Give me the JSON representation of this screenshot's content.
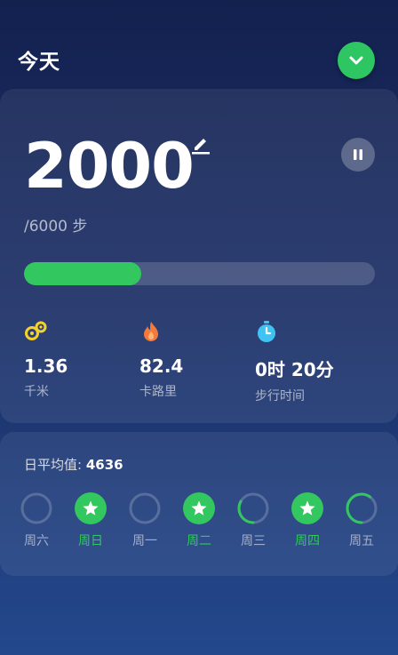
{
  "header": {
    "title": "今天"
  },
  "today": {
    "steps": "2000",
    "goal_text": "/6000 步",
    "progress": 0.333
  },
  "stats": [
    {
      "icon": "distance-icon",
      "value": "1.36",
      "label": "千米"
    },
    {
      "icon": "flame-icon",
      "value": "82.4",
      "label": "卡路里"
    },
    {
      "icon": "timer-icon",
      "value": "0时 20分",
      "label": "步行时间"
    }
  ],
  "weekly": {
    "avg_label": "日平均值:",
    "avg_value": "4636",
    "days": [
      {
        "label": "周六",
        "status": "empty",
        "progress": 0
      },
      {
        "label": "周日",
        "status": "done",
        "progress": 1
      },
      {
        "label": "周一",
        "status": "empty",
        "progress": 0
      },
      {
        "label": "周二",
        "status": "done",
        "progress": 1
      },
      {
        "label": "周三",
        "status": "partial",
        "progress": 0.33
      },
      {
        "label": "周四",
        "status": "done",
        "progress": 1
      },
      {
        "label": "周五",
        "status": "partial",
        "progress": 0.6
      }
    ]
  },
  "colors": {
    "accent": "#33c75f",
    "bg_top": "#13214f",
    "bg_bottom": "#23488c"
  }
}
